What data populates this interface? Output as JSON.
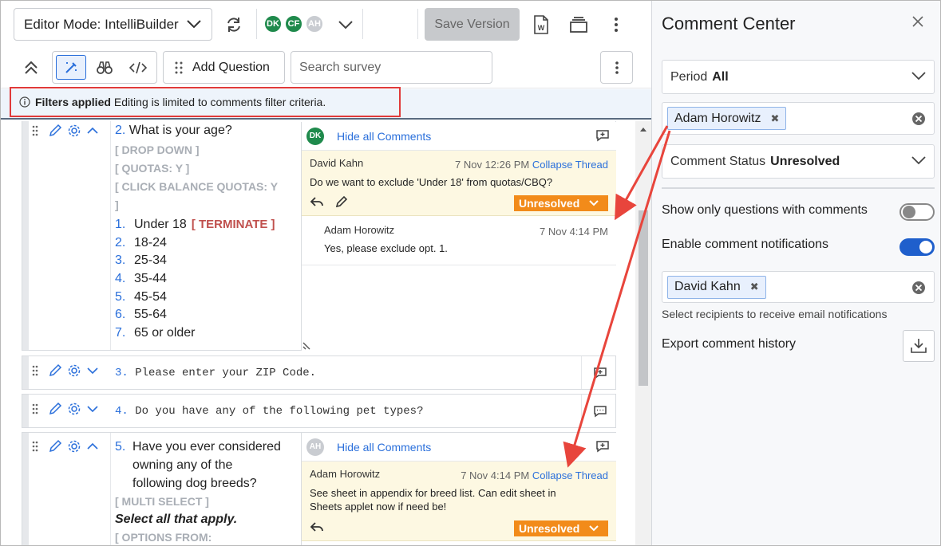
{
  "toolbar": {
    "mode_label": "Editor Mode: IntelliBuilder",
    "avatars": [
      {
        "initials": "DK",
        "color": "#1f8a4c"
      },
      {
        "initials": "CF",
        "color": "#1f8a4c"
      },
      {
        "initials": "AH",
        "color": "#c9ccd1"
      }
    ],
    "save_label": "Save Version"
  },
  "toolbar2": {
    "add_question_label": "Add Question",
    "search_placeholder": "Search survey"
  },
  "banner": {
    "bold": "Filters applied",
    "text": "Editing is limited to comments filter criteria."
  },
  "questions": {
    "q2": {
      "number": "2.",
      "title": "What is your age?",
      "tags": [
        "[ DROP DOWN ]",
        "[ QUOTAS: Y ]",
        "[ CLICK BALANCE QUOTAS: Y",
        "]"
      ],
      "options": [
        {
          "n": "1.",
          "label": "Under 18",
          "tag": "[ TERMINATE ]"
        },
        {
          "n": "2.",
          "label": "18-24"
        },
        {
          "n": "3.",
          "label": "25-34"
        },
        {
          "n": "4.",
          "label": "35-44"
        },
        {
          "n": "5.",
          "label": "45-54"
        },
        {
          "n": "6.",
          "label": "55-64"
        },
        {
          "n": "7.",
          "label": "65 or older"
        }
      ],
      "comments": {
        "avatar": "DK",
        "avatar_color": "#1f8a4c",
        "hide_label": "Hide all Comments",
        "thread": {
          "author": "David Kahn",
          "time": "7 Nov 12:26 PM",
          "collapse": "Collapse Thread",
          "message": "Do we want to exclude 'Under 18' from quotas/CBQ?",
          "status": "Unresolved"
        },
        "reply": {
          "author": "Adam Horowitz",
          "time": "7 Nov 4:14 PM",
          "message": "Yes, please exclude opt. 1."
        }
      }
    },
    "q3": {
      "number": "3.",
      "title": "Please enter your ZIP Code."
    },
    "q4": {
      "number": "4.",
      "title": "Do you have any of the following pet types?"
    },
    "q5": {
      "number": "5.",
      "title_lines": [
        "Have you ever considered",
        "owning any of the",
        "following dog breeds?"
      ],
      "tag": "[ MULTI SELECT ]",
      "instruction": "Select all that apply.",
      "tag2": "[ OPTIONS FROM:",
      "comments": {
        "avatar": "AH",
        "avatar_color": "#c9ccd1",
        "hide_label": "Hide all Comments",
        "thread": {
          "author": "Adam Horowitz",
          "time": "7 Nov 4:14 PM",
          "collapse": "Collapse Thread",
          "message": "See sheet in appendix for breed list. Can edit sheet in Sheets applet now if need be!",
          "status": "Unresolved"
        }
      }
    }
  },
  "comment_center": {
    "title": "Comment Center",
    "period_label": "Period",
    "period_value": "All",
    "author_chip": "Adam Horowitz",
    "status_label": "Comment Status",
    "status_value": "Unresolved",
    "show_only_label": "Show only questions with comments",
    "show_only_on": false,
    "notify_label": "Enable comment notifications",
    "notify_on": true,
    "recipient_chip": "David Kahn",
    "recipients_hint": "Select recipients to receive email notifications",
    "export_label": "Export comment history"
  },
  "colors": {
    "accent": "#2a6fdb",
    "unresolved": "#f28b1a",
    "annotation": "#e03a3a",
    "thread_bg": "#fdf8e2"
  }
}
